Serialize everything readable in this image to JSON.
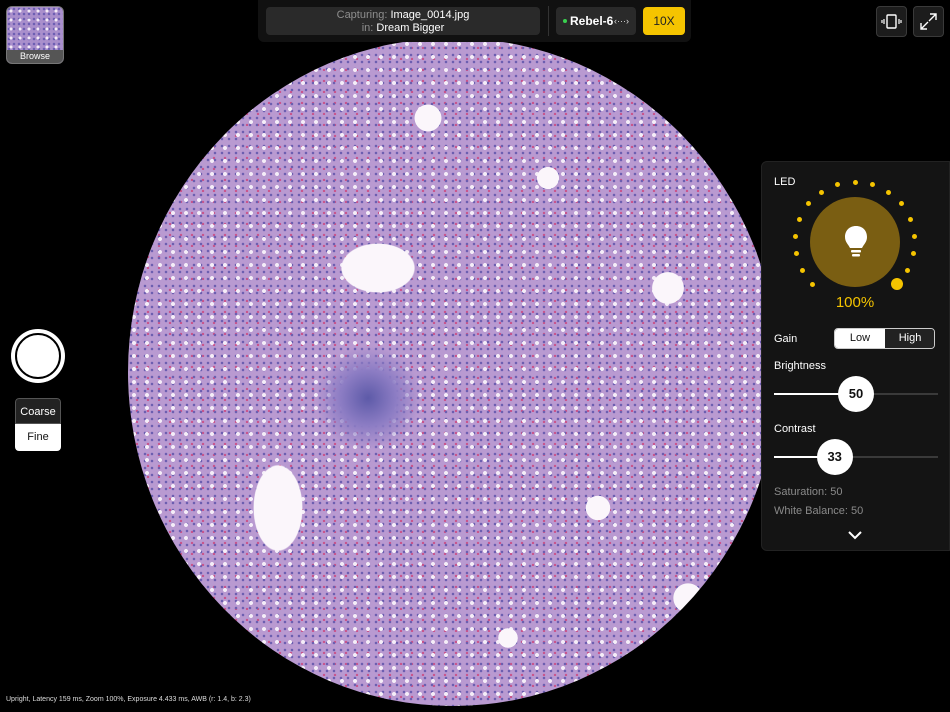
{
  "app": {
    "browse_label": "Browse",
    "capturing_prefix": "Capturing:",
    "capturing_file": "Image_0014.jpg",
    "in_prefix": "in:",
    "in_folder": "Dream Bigger",
    "device_name": "Rebel-6",
    "device_status_color": "#39d14f",
    "zoom_label": "10X",
    "accent_color": "#f5c400"
  },
  "focus": {
    "coarse_label": "Coarse",
    "fine_label": "Fine"
  },
  "panel": {
    "led_label": "LED",
    "led_percent": "100%",
    "led_level": 1.0,
    "gain_label": "Gain",
    "gain_low": "Low",
    "gain_high": "High",
    "gain_selected": "Low",
    "brightness_label": "Brightness",
    "brightness_value": "50",
    "brightness_fraction": 0.5,
    "contrast_label": "Contrast",
    "contrast_value": "33",
    "contrast_fraction": 0.37,
    "saturation_text": "Saturation: 50",
    "white_balance_text": "White Balance: 50"
  },
  "icons": {
    "bulb": "lightbulb-icon",
    "swap": "swap-arrows-icon",
    "rotate": "rotate-device-icon",
    "fullscreen": "expand-icon",
    "chevron": "chevron-down-icon"
  },
  "status_bar": {
    "text": "Upright, Latency 159 ms, Zoom 100%, Exposure 4.433 ms, AWB (r: 1.4, b: 2.3)"
  }
}
